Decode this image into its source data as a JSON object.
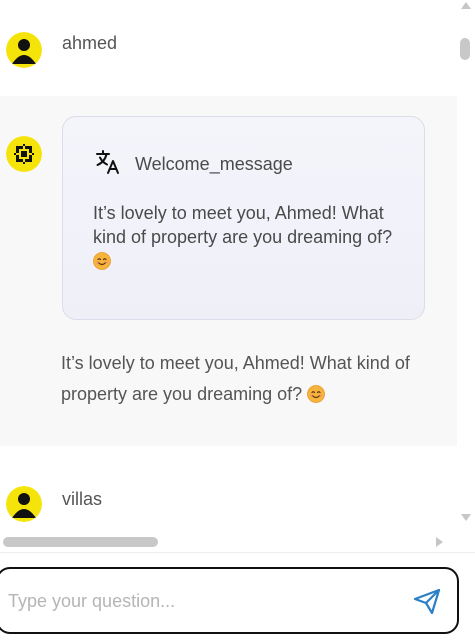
{
  "messages": [
    {
      "role": "user",
      "text": "ahmed"
    },
    {
      "role": "bot",
      "card": {
        "icon": "translate-icon",
        "title": "Welcome_message",
        "body": "It’s lovely to meet you, Ahmed! What kind of property are you dreaming of?"
      },
      "text": "It’s lovely to meet you, Ahmed! What kind of property are you dreaming of?"
    },
    {
      "role": "user",
      "text": "villas"
    }
  ],
  "composer": {
    "placeholder": "Type your question...",
    "value": "",
    "send_icon": "send-icon"
  },
  "colors": {
    "avatar_bg": "#f5e409",
    "bot_block_bg": "#f8f8f8",
    "send_icon": "#2a7fc7",
    "input_border": "#111111"
  }
}
